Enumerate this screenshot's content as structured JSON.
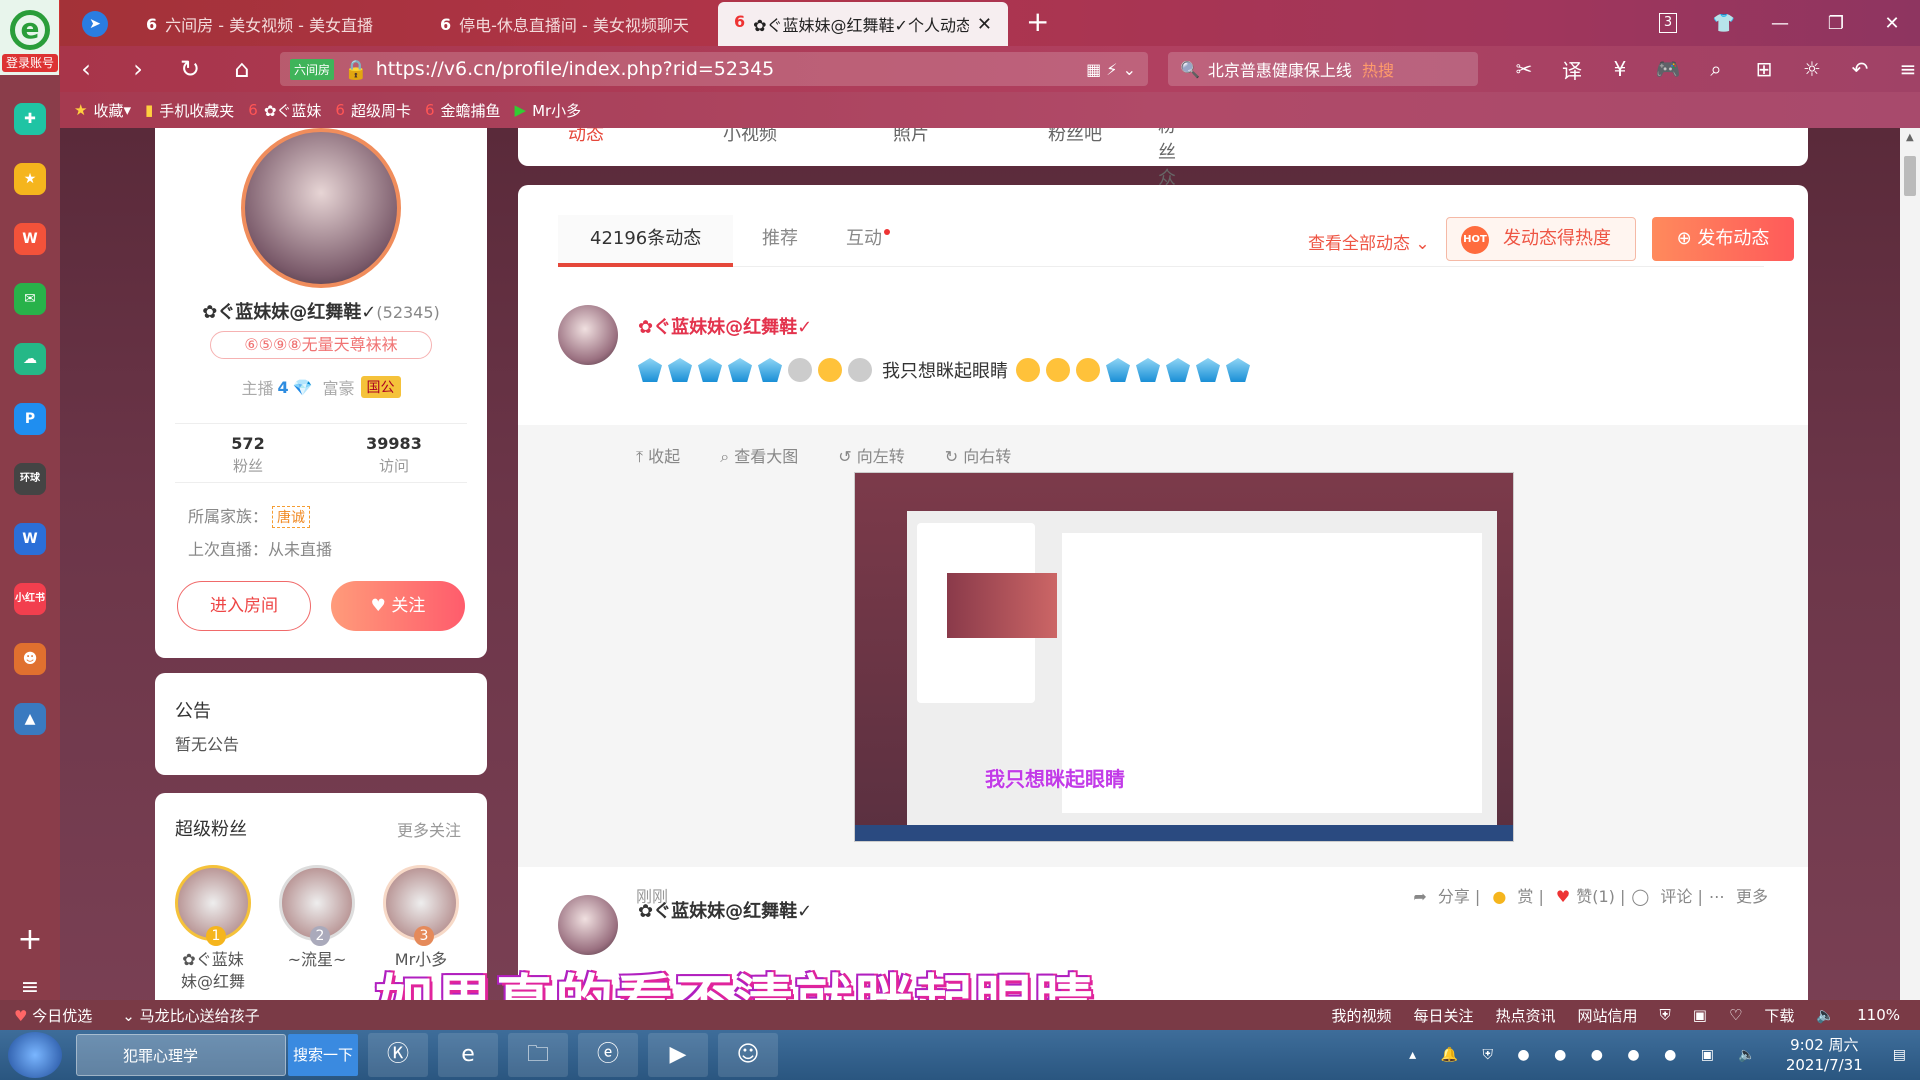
{
  "browser": {
    "account_label": "登录账号",
    "tabs": [
      {
        "title": "六间房 - 美女视频 - 美女直播"
      },
      {
        "title": "停电-休息直播间 - 美女视频聊天"
      },
      {
        "title": "✿ぐ蓝妹妹@红舞鞋✓个人动态"
      }
    ],
    "tab_count": "3",
    "url_tag": "六间房",
    "url": "https://v6.cn/profile/index.php?rid=52345",
    "search_text": "北京普惠健康保上线",
    "search_hot": "热搜",
    "bookmarks": [
      {
        "label": "收藏"
      },
      {
        "label": "手机收藏夹"
      },
      {
        "label": "✿ぐ蓝妹"
      },
      {
        "label": "超级周卡"
      },
      {
        "label": "金蟾捕鱼"
      },
      {
        "label": "Mr小多"
      }
    ]
  },
  "profile": {
    "name": "✿ぐ蓝妹妹@红舞鞋✓",
    "rid": "(52345)",
    "badge": "⑥⑤⑨⑧无量天尊袜袜",
    "anchor_label": "主播",
    "anchor_level": "4",
    "rich_label": "富豪",
    "rich_tag": "国公",
    "fans_count": "572",
    "fans_label": "粉丝",
    "visits_count": "39983",
    "visits_label": "访问",
    "family_label": "所属家族：",
    "family_name": "唐诚",
    "last_live": "上次直播：从未直播",
    "enter_room": "进入房间",
    "follow": "关注"
  },
  "notice": {
    "title": "公告",
    "content": "暂无公告"
  },
  "super_fans": {
    "title": "超级粉丝",
    "more": "更多关注",
    "items": [
      {
        "rank": "1",
        "name": "✿ぐ蓝妹\n妹@红舞"
      },
      {
        "rank": "2",
        "name": "~流星~"
      },
      {
        "rank": "3",
        "name": "Mr小多"
      }
    ]
  },
  "top_tabs": [
    "动态",
    "小视频",
    "照片",
    "粉丝吧",
    "粉丝众筹"
  ],
  "feed": {
    "tabs": [
      "42196条动态",
      "推荐",
      "互动"
    ],
    "view_all": "查看全部动态",
    "heat_button": "发动态得热度",
    "publish_button": "发布动态",
    "post": {
      "author": "✿ぐ蓝妹妹@红舞鞋✓",
      "text": "我只想眯起眼睛",
      "image_tools": [
        "收起",
        "查看大图",
        "向左转",
        "向右转"
      ],
      "time": "刚刚",
      "actions": [
        "分享",
        "赏",
        "赞(1)",
        "评论",
        "更多"
      ]
    },
    "inner_caption": "我只想眯起眼睛",
    "next_author": "✿ぐ蓝妹妹@红舞鞋✓"
  },
  "video_caption": "如果真的看不清就眯起眼睛",
  "bottom_bar": {
    "left": [
      "今日优选",
      "马龙比心送给孩子"
    ],
    "right": [
      "我的视频",
      "每日关注",
      "热点资讯",
      "网站信用",
      "下载",
      "110%"
    ]
  },
  "taskbar": {
    "ie_label": "犯罪心理学",
    "search_btn": "搜索一下",
    "time": "9:02 周六",
    "date": "2021/7/31"
  },
  "colors": {
    "accent": "#e5473a",
    "brand_red": "#e3334d",
    "follow_gradient_end": "#ff5c6c"
  }
}
